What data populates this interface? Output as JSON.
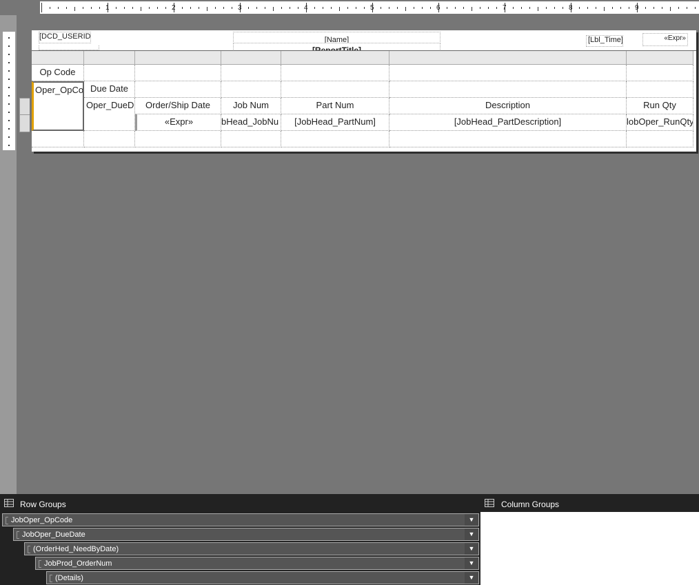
{
  "ruler": {
    "numbers": [
      "1",
      "2",
      "3",
      "4",
      "5",
      "6",
      "7",
      "8",
      "9"
    ]
  },
  "report": {
    "page_header": {
      "user_id": "[DCD_USERID",
      "name_expr": "[Name]",
      "report_title": "[ReportTitle]",
      "lbl_time": "[Lbl_Time]",
      "time_expr": "«Expr»"
    },
    "tablix": {
      "header_row1": "Op Code",
      "header_row2_col1": "Oper_OpCo",
      "header_row2_col2": "Due Date",
      "col_headers": [
        "Oper_DueD",
        "Order/Ship Date",
        "Job Num",
        "Part Num",
        "Description",
        "Run Qty"
      ],
      "detail_values": [
        "«Expr»",
        "bHead_JobNu",
        "[JobHead_PartNum]",
        "[JobHead_PartDescription]",
        "lobOper_RunQty"
      ]
    }
  },
  "panels": {
    "row_groups_title": "Row Groups",
    "column_groups_title": "Column Groups",
    "row_groups": [
      {
        "label": "JobOper_OpCode"
      },
      {
        "label": "JobOper_DueDate"
      },
      {
        "label": "(OrderHed_NeedByDate)"
      },
      {
        "label": "JobProd_OrderNum"
      },
      {
        "label": "(Details)"
      }
    ],
    "dropdown_icon": "triangle-down-icon"
  }
}
